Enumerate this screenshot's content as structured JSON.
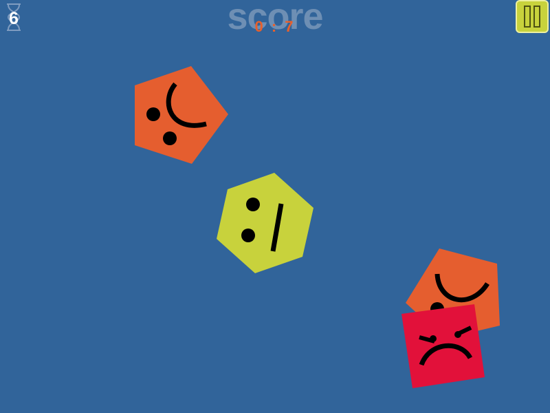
{
  "hud": {
    "timer_value": "6",
    "score_title": "score",
    "score_value": "0 : 7",
    "pause_icon": "pause-icon"
  },
  "colors": {
    "background": "#31649a",
    "orange_shape": "#e55e2f",
    "yellow_shape": "#c8d23c",
    "red_shape": "#e2113a",
    "face_features": "#000000",
    "score_value": "#e8602c",
    "score_title": "#6e8fb4"
  },
  "shapes": [
    {
      "kind": "pentagon",
      "color": "orange",
      "expression": "sad"
    },
    {
      "kind": "hexagon",
      "color": "yellow",
      "expression": "neutral"
    },
    {
      "kind": "pentagon",
      "color": "orange",
      "expression": "sad"
    },
    {
      "kind": "square",
      "color": "red",
      "expression": "angry"
    }
  ]
}
